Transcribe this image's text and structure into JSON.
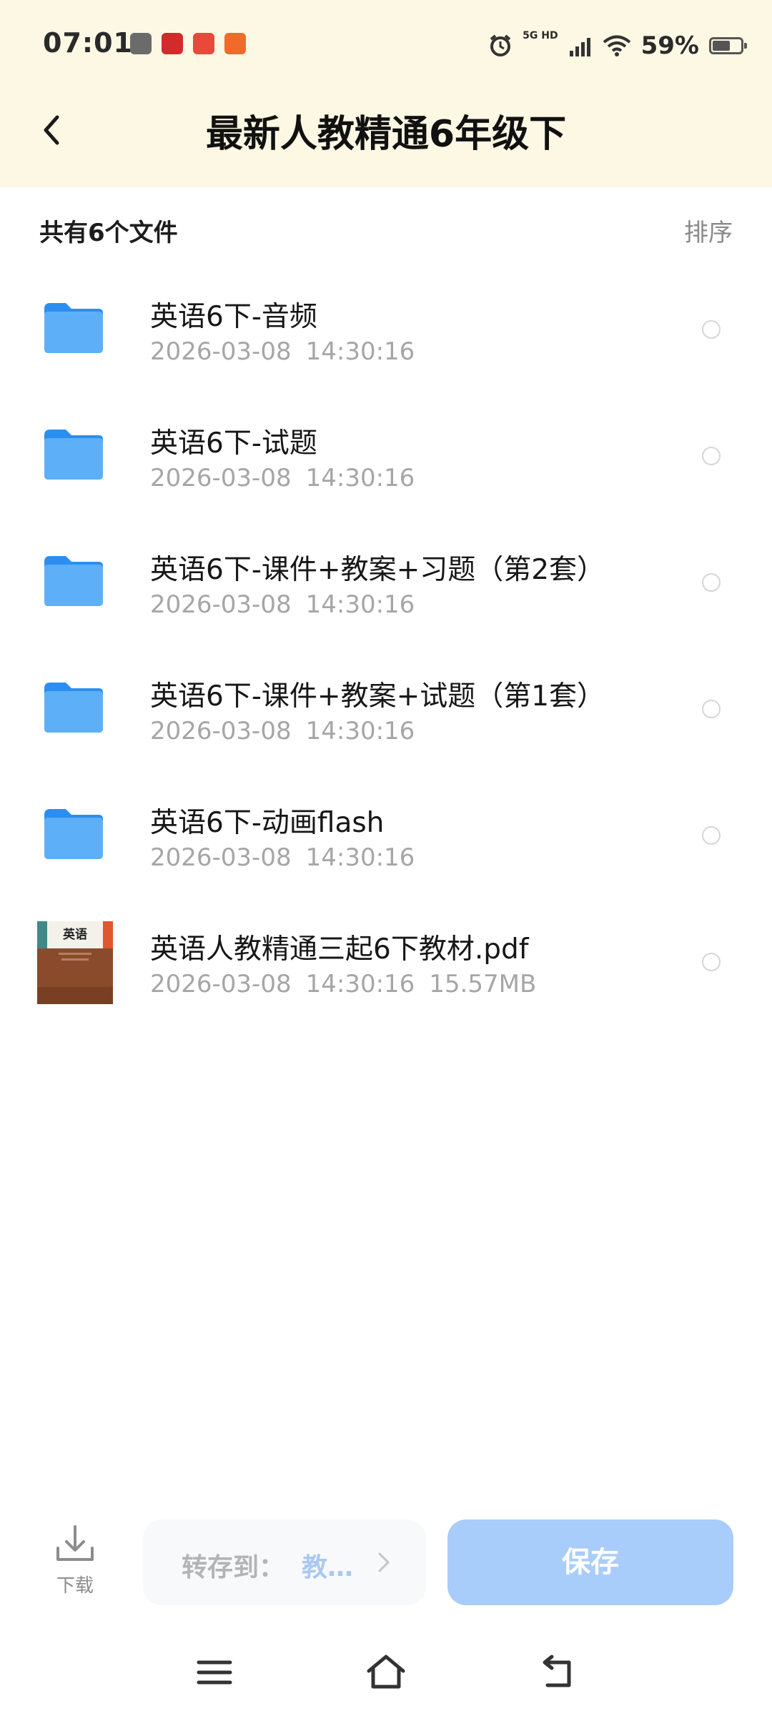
{
  "status_bar": {
    "time": "07:01",
    "network": "5G HD",
    "battery_percent": "59%",
    "icons": [
      "voice-app-icon",
      "news-app-icon",
      "game-app-icon",
      "shopping-app-icon",
      "alarm-icon",
      "signal-icon",
      "wifi-icon",
      "battery-icon"
    ]
  },
  "header": {
    "title": "最新人教精通6年级下"
  },
  "summary": {
    "count_label": "共有6个文件",
    "sort_label": "排序"
  },
  "files": [
    {
      "name": "英语6下-音频",
      "date": "2026-03-08",
      "time": "14:30:16",
      "size": "",
      "type": "folder"
    },
    {
      "name": "英语6下-试题",
      "date": "2026-03-08",
      "time": "14:30:16",
      "size": "",
      "type": "folder"
    },
    {
      "name": "英语6下-课件+教案+习题（第2套）",
      "date": "2026-03-08",
      "time": "14:30:16",
      "size": "",
      "type": "folder"
    },
    {
      "name": "英语6下-课件+教案+试题（第1套）",
      "date": "2026-03-08",
      "time": "14:30:16",
      "size": "",
      "type": "folder"
    },
    {
      "name": "英语6下-动画flash",
      "date": "2026-03-08",
      "time": "14:30:16",
      "size": "",
      "type": "folder"
    },
    {
      "name": "英语人教精通三起6下教材.pdf",
      "date": "2026-03-08",
      "time": "14:30:16",
      "size": "15.57MB",
      "type": "pdf",
      "thumb_text": "英语"
    }
  ],
  "bottom_bar": {
    "download_label": "下载",
    "save_to_label": "转存到：",
    "save_to_value": "教…",
    "save_button": "保存"
  },
  "colors": {
    "header_bg": "#fcf8e4",
    "folder_blue": "#4aa3f5",
    "save_button": "#a9cdfa",
    "meta_gray": "#a6a6a6"
  }
}
